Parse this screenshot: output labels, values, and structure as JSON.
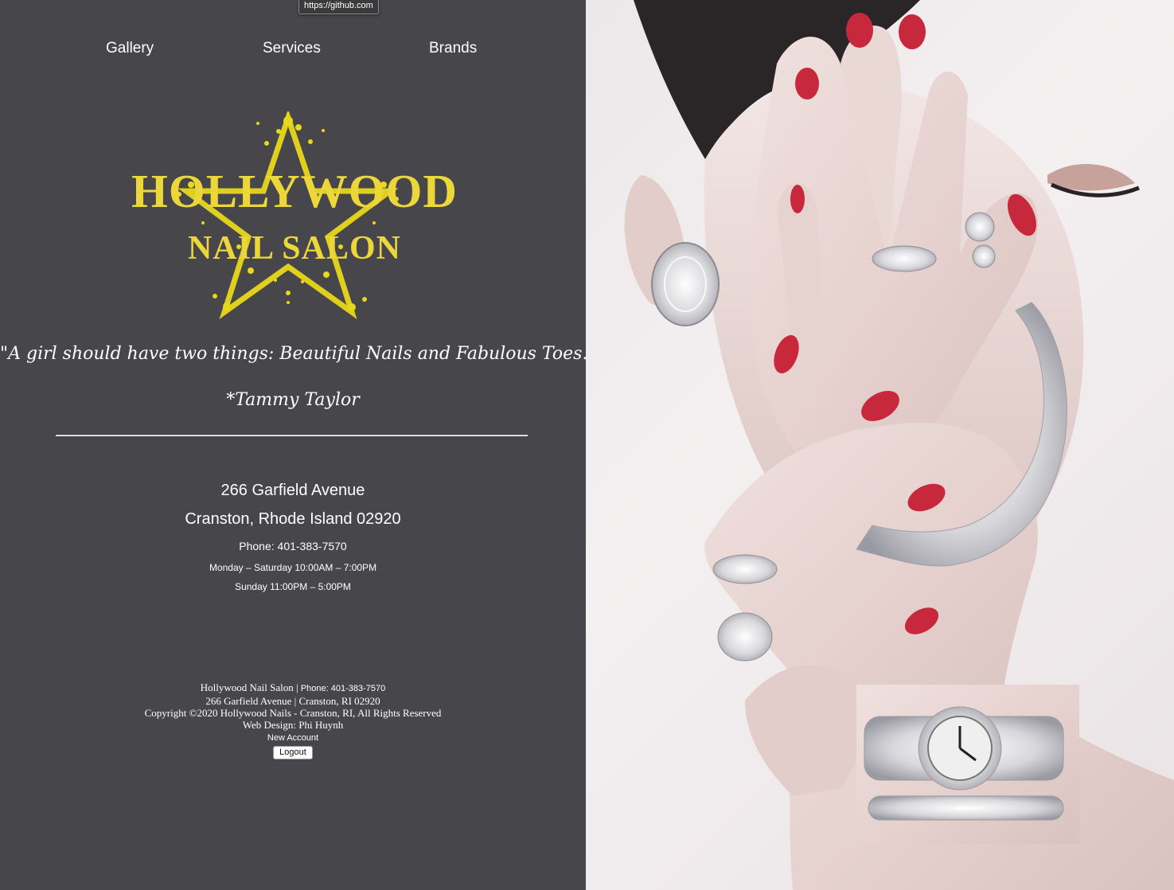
{
  "tooltip": {
    "url": "https://github.com"
  },
  "nav": {
    "items": [
      "Gallery",
      "Services",
      "Brands"
    ]
  },
  "logo": {
    "line1": "HOLLYWOOD",
    "line2": "NAIL SALON",
    "color": "#ecd63a"
  },
  "quote": {
    "text": "\"A girl should have two things: Beautiful Nails and Fabulous Toes.\"",
    "author": "*Tammy Taylor"
  },
  "contact": {
    "address_line1": "266 Garfield Avenue",
    "address_line2": "Cranston, Rhode Island 02920",
    "phone": "Phone: 401-383-7570",
    "hours_weekday": "Monday – Saturday 10:00AM – 7:00PM",
    "hours_sunday": "Sunday 11:00PM – 5:00PM"
  },
  "footer": {
    "business_name": "Hollywood Nail Salon",
    "separator": "|",
    "phone": "Phone: 401-383-7570",
    "address": "266 Garfield Avenue | Cranston, RI 02920",
    "copyright": "Copyright ©2020 Hollywood Nails - Cranston, RI, All Rights Reserved",
    "web_design": "Web Design: Phi Huynh",
    "new_account_label": "New Account",
    "logout_label": "Logout"
  },
  "colors": {
    "background": "#46464b",
    "text": "#ffffff",
    "nail_red": "#c8283c"
  }
}
